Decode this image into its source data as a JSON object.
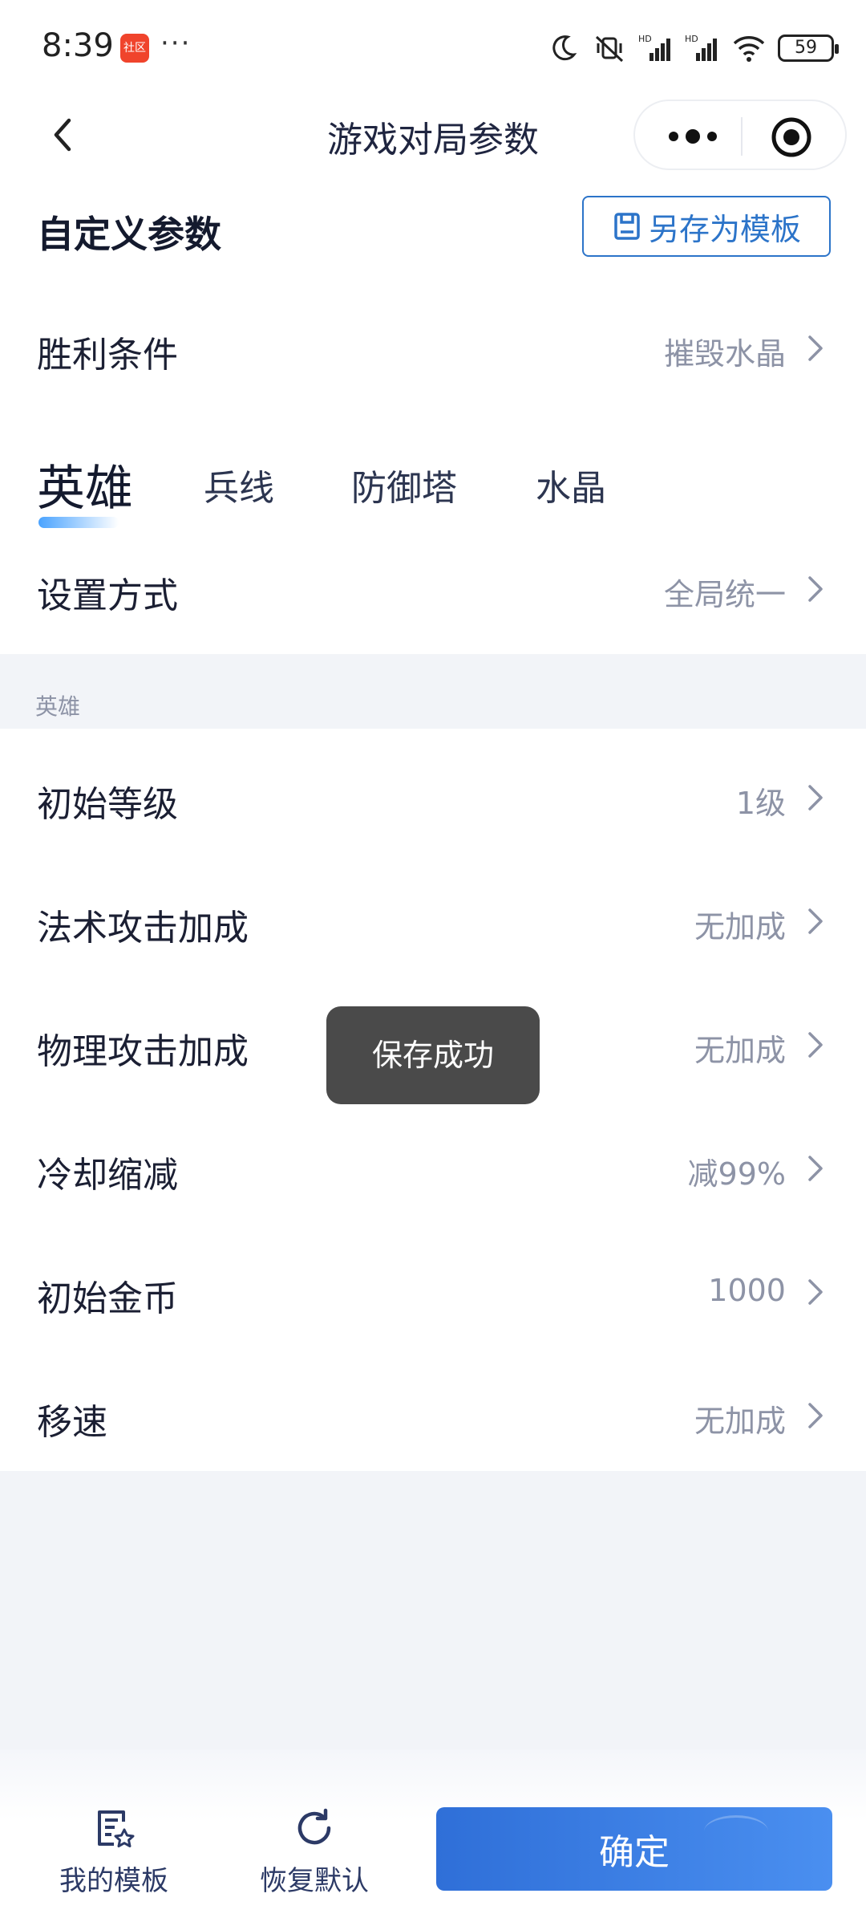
{
  "status_bar": {
    "time": "8:39",
    "app_badge": "社区",
    "more": "···",
    "battery": "59"
  },
  "nav": {
    "title": "游戏对局参数"
  },
  "header": {
    "title": "自定义参数",
    "save_template": "另存为模板"
  },
  "victory": {
    "label": "胜利条件",
    "value": "摧毁水晶"
  },
  "tabs": [
    {
      "label": "英雄",
      "active": true
    },
    {
      "label": "兵线",
      "active": false
    },
    {
      "label": "防御塔",
      "active": false
    },
    {
      "label": "水晶",
      "active": false
    }
  ],
  "setting_mode": {
    "label": "设置方式",
    "value": "全局统一"
  },
  "group_title": "英雄",
  "rows": [
    {
      "label": "初始等级",
      "value": "1级"
    },
    {
      "label": "法术攻击加成",
      "value": "无加成"
    },
    {
      "label": "物理攻击加成",
      "value": "无加成"
    },
    {
      "label": "冷却缩减",
      "value": "减99%"
    },
    {
      "label": "初始金币",
      "value": "1000"
    },
    {
      "label": "移速",
      "value": "无加成"
    }
  ],
  "toast": "保存成功",
  "bottom": {
    "my_templates": "我的模板",
    "restore_default": "恢复默认",
    "confirm": "确定"
  },
  "colors": {
    "accent": "#2c74c9",
    "confirm": "#3b7fe4",
    "value_text": "#8d93a6",
    "background": "#f2f4f8"
  }
}
